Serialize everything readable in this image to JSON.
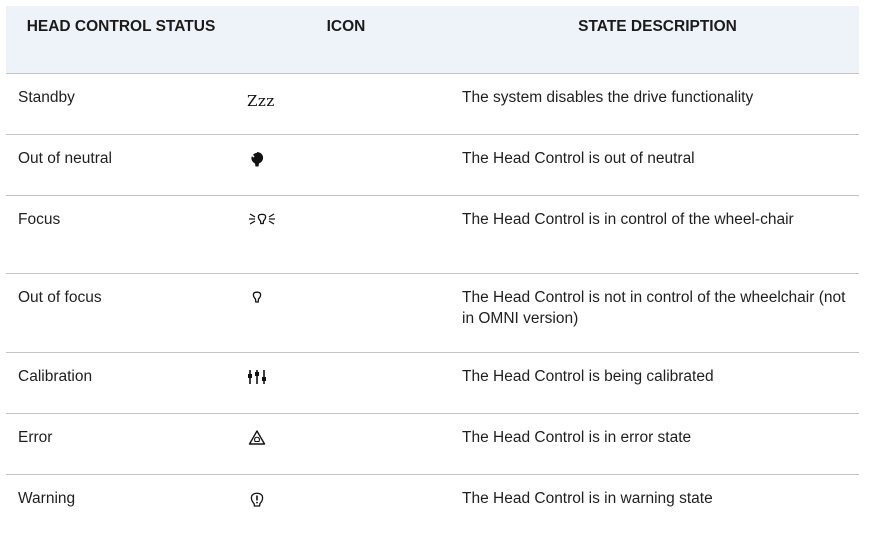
{
  "table": {
    "headers": {
      "status": "HEAD CONTROL STATUS",
      "icon": "ICON",
      "description": "STATE DESCRIPTION"
    },
    "rows": [
      {
        "status": "Standby",
        "icon": "zzz-sleep-icon",
        "icon_text": "Zzz",
        "description": "The system disables the drive functionality"
      },
      {
        "status": "Out of neutral",
        "icon": "head-out-of-neutral-icon",
        "description": "The Head Control is out of neutral"
      },
      {
        "status": "Focus",
        "icon": "head-focus-icon",
        "description": "The Head Control is in control of the wheel-chair"
      },
      {
        "status": "Out of focus",
        "icon": "head-out-of-focus-icon",
        "description": "The Head Control is not in control of the wheelchair (not in OMNI version)"
      },
      {
        "status": "Calibration",
        "icon": "calibration-sliders-icon",
        "description": "The Head Control is being calibrated"
      },
      {
        "status": "Error",
        "icon": "error-triangle-icon",
        "description": "The Head Control is in error state"
      },
      {
        "status": "Warning",
        "icon": "warning-circle-icon",
        "description": "The Head Control is in warning state"
      }
    ]
  },
  "colors": {
    "header_background": "#eef3f9",
    "row_divider": "#c4c4c4"
  }
}
